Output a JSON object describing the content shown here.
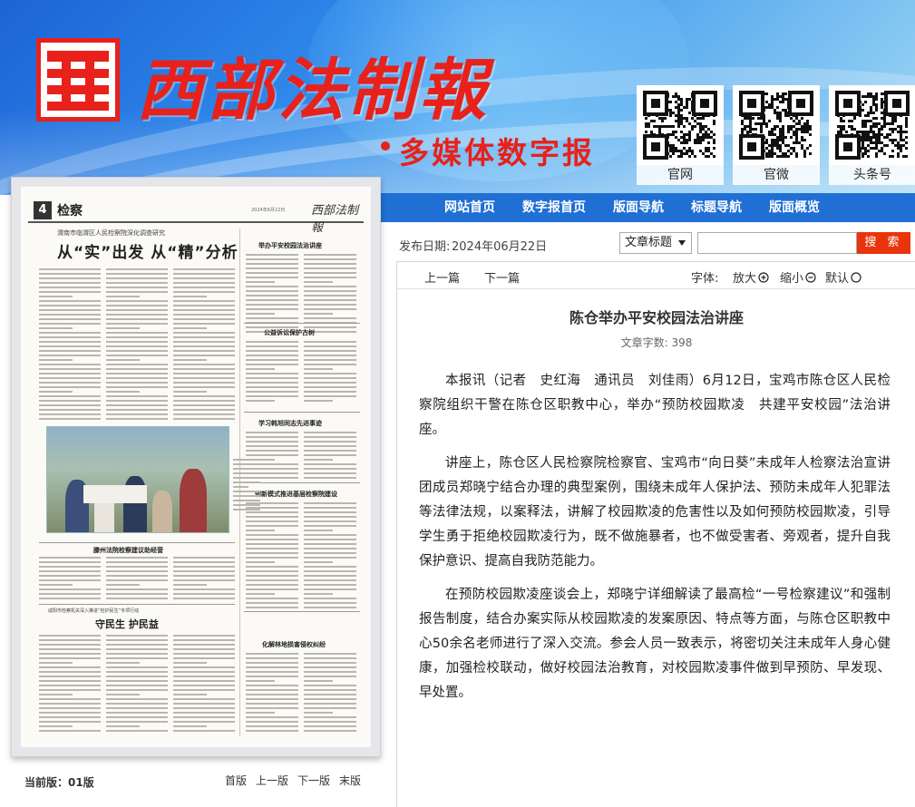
{
  "header": {
    "logo_title": "西部法制報",
    "logo_subtitle": "多媒体数字报",
    "qr_codes": [
      {
        "label": "官网"
      },
      {
        "label": "官微"
      },
      {
        "label": "头条号"
      }
    ]
  },
  "nav": {
    "items": [
      "网站首页",
      "数字报首页",
      "版面导航",
      "标题导航",
      "版面概览"
    ]
  },
  "newspaper": {
    "page_number": "4",
    "section": "检察",
    "date_line": "2024年6月22日",
    "masthead": "西部法制報",
    "kicker": "渭南市临渭区人民检察院深化调查研究",
    "headline": "从“实”出发  从“精”分析",
    "sidebar_headlines": [
      "举办平安校园法治讲座",
      "公益诉讼保护古树",
      "学习韩旭同志先进事迹",
      "创新模式推进基层检察院建设",
      "化解林地损害侵权纠纷"
    ],
    "bottom_left_headline": "滕州法院检察建议助经营",
    "bottom_kicker": "咸阳市检察机关深入推进“检护民生”专项行动",
    "bottom_headline": "守民生  护民益",
    "current_edition_label": "当前版：01版",
    "pager": [
      "首版",
      "上一版",
      "下一版",
      "末版"
    ]
  },
  "meta": {
    "publish_label": "发布日期:",
    "publish_date": "2024年06月22日",
    "search_field_value": "文章标题",
    "search_input_value": "",
    "search_button": "搜 索"
  },
  "toolbar": {
    "prev": "上一篇",
    "next": "下一篇",
    "font_label": "字体:",
    "zoom_in": "放大",
    "zoom_out": "缩小",
    "default": "默认"
  },
  "article": {
    "title": "陈仓举办平安校园法治讲座",
    "word_count_label": "文章字数:",
    "word_count": "398",
    "paragraphs": [
      "本报讯（记者　史红海　通讯员　刘佳雨）6月12日，宝鸡市陈仓区人民检察院组织干警在陈仓区职教中心，举办“预防校园欺凌　共建平安校园”法治讲座。",
      "讲座上，陈仓区人民检察院检察官、宝鸡市“向日葵”未成年人检察法治宣讲团成员郑晓宁结合办理的典型案例，围绕未成年人保护法、预防未成年人犯罪法等法律法规，以案释法，讲解了校园欺凌的危害性以及如何预防校园欺凌，引导学生勇于拒绝校园欺凌行为，既不做施暴者，也不做受害者、旁观者，提升自我保护意识、提高自我防范能力。",
      "在预防校园欺凌座谈会上，郑晓宁详细解读了最高检“一号检察建议”和强制报告制度，结合办案实际从校园欺凌的发案原因、特点等方面，与陈仓区职教中心50余名老师进行了深入交流。参会人员一致表示，将密切关注未成年人身心健康，加强检校联动，做好校园法治教育，对校园欺凌事件做到早预防、早发现、早处置。"
    ]
  },
  "colors": {
    "brand_red": "#e8211a",
    "nav_blue": "#1f6fd4",
    "search_button": "#e8350b"
  }
}
